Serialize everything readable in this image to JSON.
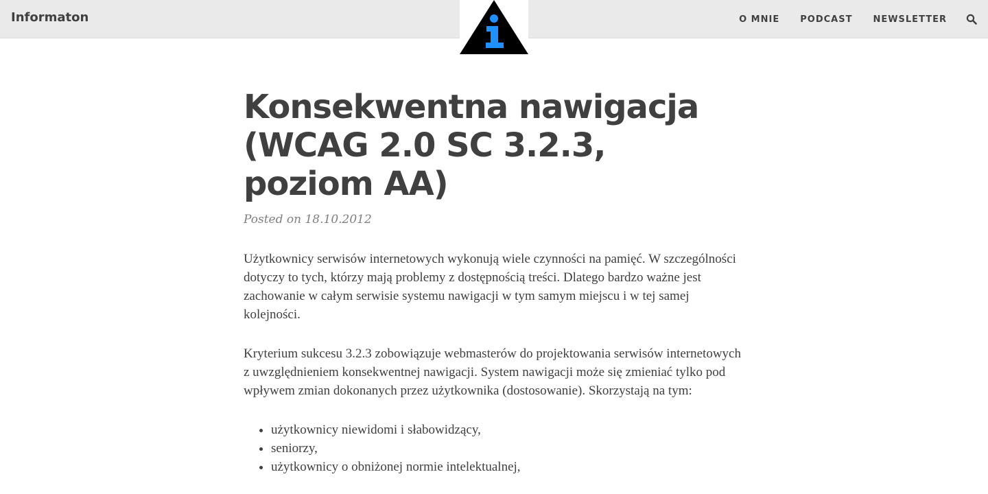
{
  "nav": {
    "brand": "Informaton",
    "links": [
      "O MNIE",
      "PODCAST",
      "NEWSLETTER"
    ],
    "search_icon": "search-icon",
    "logo_icon": "info-triangle-logo"
  },
  "colors": {
    "navbar_bg": "#eaeaea",
    "text": "#404040",
    "meta": "#808080",
    "logo_accent": "#1e90ff"
  },
  "post": {
    "title": "Konsekwentna nawigacja (WCAG 2.0 SC 3.2.3, poziom AA)",
    "meta": "Posted on 18.10.2012",
    "paragraphs": [
      "Użytkownicy serwisów internetowych wykonują wiele czynności na pamięć. W szczególności dotyczy to tych, którzy mają problemy z dostępnością treści. Dlatego bardzo ważne jest zachowanie w całym serwisie systemu nawigacji w tym samym miejscu i w tej samej kolejności.",
      "Kryterium sukcesu 3.2.3 zobowiązuje webmasterów do projektowania serwisów internetowych z uwzględnieniem konsekwentnej nawigacji. System nawigacji może się zmieniać tylko pod wpływem zmian dokonanych przez użytkownika (dostosowanie). Skorzystają na tym:"
    ],
    "list": [
      "użytkownicy niewidomi i słabowidzący,",
      "seniorzy,",
      "użytkownicy o obniżonej normie intelektualnej,"
    ]
  }
}
